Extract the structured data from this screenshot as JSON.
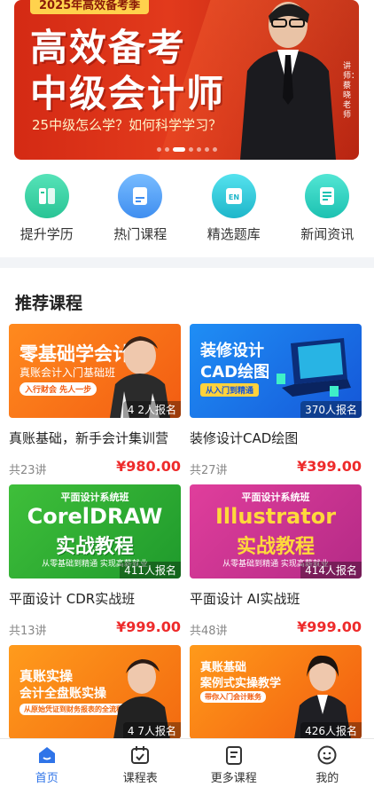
{
  "banner": {
    "tag": "2025年高效备考季",
    "title_line1": "高效备考",
    "title_line2": "中级会计师",
    "subtitle": "25中级怎么学？如何科学学习？",
    "teacher_label": "讲师：蔡晓老师",
    "slide_count": 7,
    "active_slide": 3
  },
  "quicknav": [
    {
      "label": "提升学历",
      "icon": "book-icon",
      "color": "#3fd3a6"
    },
    {
      "label": "热门课程",
      "icon": "course-icon",
      "color": "#5aa8f4"
    },
    {
      "label": "精选题库",
      "icon": "question-bank-icon",
      "color": "#33c8d8"
    },
    {
      "label": "新闻资讯",
      "icon": "news-icon",
      "color": "#2fd0c4"
    }
  ],
  "section_title": "推荐课程",
  "courses": [
    {
      "title": "真账基础，新手会计集训营",
      "lessons": "共23讲",
      "price": "¥980.00",
      "enrolled": "4 2人报名",
      "thumb_line1": "零基础学会计",
      "thumb_line2": "真账会计入门基础班",
      "thumb_badge": "入行财会 先人一步"
    },
    {
      "title": "装修设计CAD绘图",
      "lessons": "共27讲",
      "price": "¥399.00",
      "enrolled": "370人报名",
      "thumb_line1": "装修设计",
      "thumb_line2": "CAD绘图",
      "thumb_badge": "从入门到精通"
    },
    {
      "title": "平面设计 CDR实战班",
      "lessons": "共13讲",
      "price": "¥999.00",
      "enrolled": "411人报名",
      "thumb_line1": "平面设计系统班",
      "thumb_line2": "CorelDRAW",
      "thumb_line3": "实战教程",
      "thumb_badge": "从零基础到精通 实现高薪就业"
    },
    {
      "title": "平面设计 AI实战班",
      "lessons": "共48讲",
      "price": "¥999.00",
      "enrolled": "414人报名",
      "thumb_line1": "平面设计系统班",
      "thumb_line2": "Illustrator",
      "thumb_line3": "实战教程",
      "thumb_badge": "从零基础到精通 实现高薪就业"
    },
    {
      "title": "",
      "lessons": "",
      "price": "",
      "enrolled": "4 7人报名",
      "thumb_line1": "真账实操",
      "thumb_line2": "会计全盘账实操",
      "thumb_badge": "从原始凭证到财务报表的全流程"
    },
    {
      "title": "",
      "lessons": "",
      "price": "",
      "enrolled": "426人报名",
      "thumb_line1": "真账基础",
      "thumb_line2": "案例式实操教学",
      "thumb_badge": "带你入门会计账务"
    }
  ],
  "tabbar": [
    {
      "label": "首页",
      "icon": "home-icon",
      "active": true
    },
    {
      "label": "课程表",
      "icon": "calendar-icon",
      "active": false
    },
    {
      "label": "更多课程",
      "icon": "courses-icon",
      "active": false
    },
    {
      "label": "我的",
      "icon": "profile-icon",
      "active": false
    }
  ],
  "colors": {
    "accent": "#2f74e8",
    "price": "#ee2b2b",
    "banner": "#d42a14"
  }
}
